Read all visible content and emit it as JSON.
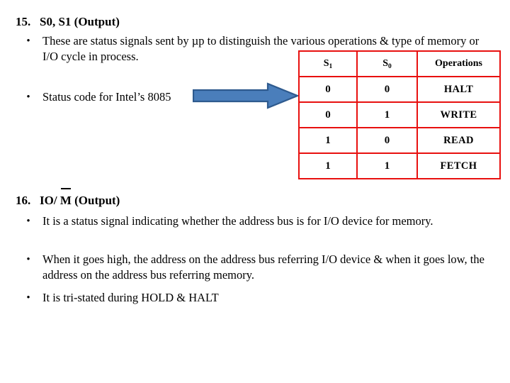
{
  "slide": {
    "background_color": "#ffffff",
    "accent_red": "#e8100f",
    "arrow_fill": "#4a7ebb",
    "arrow_stroke": "#2e5a8e"
  },
  "section_15": {
    "number": "15.",
    "title": "S0, S1 (Output)",
    "bullets": [
      "These are status signals sent by µp to distinguish the various operations & type of memory or I/O cycle in process.",
      "Status code for Intel’s 8085"
    ]
  },
  "section_16": {
    "number": "16.",
    "title_prefix": "IO/ ",
    "title_overbar": "M",
    "title_suffix": " (Output)",
    "bullets": [
      "It is a status signal indicating whether the address bus is for I/O device for memory.",
      "When it goes high, the address on the address bus referring I/O  device & when it goes low, the address on the address bus referring memory.",
      "It is tri-stated during HOLD & HALT"
    ]
  },
  "status_table": {
    "headers": [
      "S1",
      "S0",
      "Operations"
    ],
    "header_sub": [
      "1",
      "0",
      ""
    ],
    "header_base": [
      "S",
      "S",
      "Operations"
    ],
    "rows": [
      {
        "s1": "0",
        "s0": "0",
        "operation": "HALT"
      },
      {
        "s1": "0",
        "s0": "1",
        "operation": "WRITE"
      },
      {
        "s1": "1",
        "s0": "0",
        "operation": "READ"
      },
      {
        "s1": "1",
        "s0": "1",
        "operation": "FETCH"
      }
    ]
  },
  "arrow": {
    "label": "pointer-arrow",
    "direction": "right"
  }
}
